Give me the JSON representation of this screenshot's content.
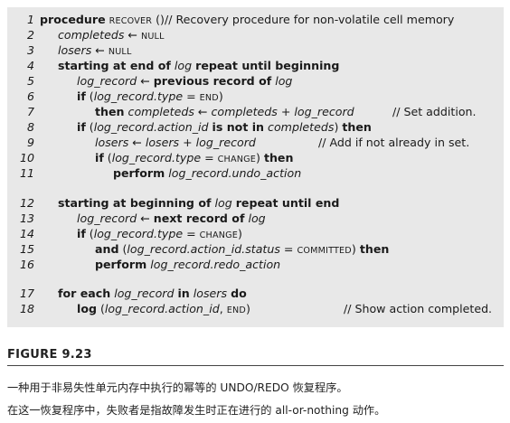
{
  "code_lines": [
    {
      "num": "1",
      "parts": [
        "procedure",
        "RECOVER",
        " ()// Recovery procedure for non-volatile cell memory"
      ]
    },
    {
      "num": "2",
      "parts": [
        "completeds",
        " ← ",
        "NULL"
      ]
    },
    {
      "num": "3",
      "parts": [
        "losers",
        " ← ",
        "NULL"
      ]
    },
    {
      "num": "4",
      "parts": [
        "starting at end of",
        "log",
        "repeat until beginning"
      ]
    },
    {
      "num": "5",
      "parts": [
        "log_record",
        " ← ",
        "previous record of",
        "log"
      ]
    },
    {
      "num": "6",
      "parts": [
        "if",
        " (",
        "log_record.type",
        " = ",
        "END",
        ")"
      ]
    },
    {
      "num": "7",
      "parts": [
        "then",
        "completeds",
        " ← ",
        "completeds",
        " + ",
        "log_record"
      ],
      "comment": "// Set addition."
    },
    {
      "num": "8",
      "parts": [
        "if",
        " (",
        "log_record.action_id",
        "is not in",
        "completeds",
        ")",
        "then"
      ]
    },
    {
      "num": "9",
      "parts": [
        "losers",
        " ← ",
        "losers",
        " + ",
        "log_record"
      ],
      "comment": "// Add if not already in set."
    },
    {
      "num": "10",
      "parts": [
        "if",
        " (",
        "log_record.type",
        " = ",
        "CHANGE",
        ")",
        "then"
      ]
    },
    {
      "num": "11",
      "parts": [
        "perform",
        "log_record.undo_action"
      ]
    },
    {
      "num": "12",
      "parts": [
        "starting at beginning of",
        "log",
        "repeat until end"
      ]
    },
    {
      "num": "13",
      "parts": [
        "log_record",
        " ← ",
        "next record of",
        "log"
      ]
    },
    {
      "num": "14",
      "parts": [
        "if",
        " (",
        "log_record.type",
        " = ",
        "CHANGE",
        ")"
      ]
    },
    {
      "num": "15",
      "parts": [
        "and",
        " (",
        "log_record.action_id.status",
        " = ",
        "COMMITTED",
        ")",
        "then"
      ]
    },
    {
      "num": "16",
      "parts": [
        "perform",
        "log_record.redo_action"
      ]
    },
    {
      "num": "17",
      "parts": [
        "for each",
        "log_record",
        "in",
        "losers",
        "do"
      ]
    },
    {
      "num": "18",
      "parts": [
        "log",
        " (",
        "log_record.action_id",
        ", ",
        "END",
        ")"
      ],
      "comment": "// Show action completed."
    }
  ],
  "figure": {
    "title": "FIGURE 9.23",
    "caption_line1": "一种用于非易失性单元内存中执行的幂等的 UNDO/REDO 恢复程序。",
    "caption_line2": "在这一恢复程序中，失败者是指故障发生时正在进行的 all-or-nothing 动作。"
  }
}
